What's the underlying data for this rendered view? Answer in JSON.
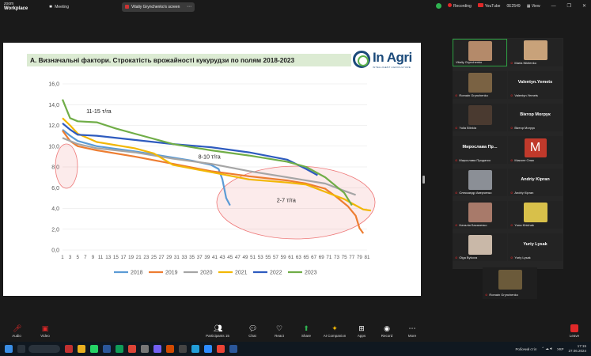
{
  "app": {
    "brand_line1": "zoom",
    "brand_line2": "Workplace"
  },
  "top_bar": {
    "meeting_label": "Meeting",
    "screen_chip": "Vitaliy Grynchenko's screen",
    "recording_label": "Recording",
    "youtube_label": "YouTube",
    "viewers_label": "0E2549"
  },
  "slide": {
    "title": "А. Визначальні фактори. Строкатість врожайності кукурудзи по полям 2018-2023",
    "logo_text": "In Agri",
    "logo_sub": "INTELLIGENT AGRICULTURE"
  },
  "chart_data": {
    "type": "line",
    "ylim": [
      0,
      16
    ],
    "yticks": [
      "0,0",
      "2,0",
      "4,0",
      "6,0",
      "8,0",
      "10,0",
      "12,0",
      "14,0",
      "16,0"
    ],
    "xticks": [
      "1",
      "3",
      "5",
      "7",
      "9",
      "11",
      "13",
      "15",
      "17",
      "19",
      "21",
      "23",
      "25",
      "27",
      "29",
      "31",
      "33",
      "35",
      "37",
      "39",
      "41",
      "43",
      "45",
      "47",
      "49",
      "51",
      "53",
      "55",
      "57",
      "59",
      "61",
      "63",
      "65",
      "67",
      "69",
      "71",
      "73",
      "75",
      "77",
      "79",
      "81"
    ],
    "annotations": [
      "11-15 т/га",
      "8-10 т/га",
      "2-7 т/га"
    ],
    "series": [
      {
        "name": "2018",
        "color": "#5b9bd5",
        "n": 45,
        "points": [
          [
            1,
            11.6
          ],
          [
            3,
            11.0
          ],
          [
            5,
            10.5
          ],
          [
            10,
            10.0
          ],
          [
            20,
            9.5
          ],
          [
            30,
            8.9
          ],
          [
            35,
            8.6
          ],
          [
            40,
            8.2
          ],
          [
            42,
            7.8
          ],
          [
            43,
            6.8
          ],
          [
            44,
            5.0
          ],
          [
            45,
            4.3
          ]
        ]
      },
      {
        "name": "2019",
        "color": "#ed7d31",
        "n": 80,
        "points": [
          [
            1,
            11.5
          ],
          [
            3,
            10.5
          ],
          [
            5,
            10.0
          ],
          [
            10,
            9.6
          ],
          [
            20,
            9.0
          ],
          [
            30,
            8.3
          ],
          [
            40,
            7.6
          ],
          [
            50,
            7.1
          ],
          [
            60,
            6.7
          ],
          [
            65,
            6.4
          ],
          [
            70,
            5.9
          ],
          [
            73,
            5.1
          ],
          [
            76,
            4.2
          ],
          [
            78,
            3.3
          ],
          [
            79,
            2.1
          ],
          [
            80,
            1.6
          ]
        ]
      },
      {
        "name": "2020",
        "color": "#a5a5a5",
        "n": 78,
        "points": [
          [
            1,
            10.8
          ],
          [
            3,
            10.5
          ],
          [
            5,
            10.2
          ],
          [
            10,
            9.8
          ],
          [
            20,
            9.4
          ],
          [
            30,
            8.8
          ],
          [
            40,
            8.3
          ],
          [
            50,
            7.6
          ],
          [
            60,
            7.0
          ],
          [
            70,
            6.4
          ],
          [
            75,
            5.7
          ],
          [
            78,
            5.3
          ]
        ]
      },
      {
        "name": "2021",
        "color": "#f2b705",
        "n": 82,
        "points": [
          [
            1,
            12.7
          ],
          [
            3,
            12.0
          ],
          [
            5,
            11.2
          ],
          [
            10,
            10.4
          ],
          [
            20,
            9.8
          ],
          [
            25,
            9.3
          ],
          [
            30,
            8.2
          ],
          [
            40,
            7.5
          ],
          [
            50,
            6.8
          ],
          [
            60,
            6.5
          ],
          [
            65,
            6.3
          ],
          [
            70,
            5.6
          ],
          [
            75,
            4.9
          ],
          [
            78,
            4.3
          ],
          [
            80,
            3.9
          ],
          [
            82,
            3.8
          ]
        ]
      },
      {
        "name": "2022",
        "color": "#2e5bbf",
        "n": 68,
        "points": [
          [
            1,
            12.2
          ],
          [
            3,
            11.6
          ],
          [
            5,
            11.1
          ],
          [
            10,
            11.0
          ],
          [
            20,
            10.6
          ],
          [
            30,
            10.2
          ],
          [
            40,
            9.9
          ],
          [
            50,
            9.4
          ],
          [
            60,
            8.7
          ],
          [
            65,
            7.8
          ],
          [
            68,
            7.2
          ]
        ]
      },
      {
        "name": "2023",
        "color": "#70ad47",
        "n": 77,
        "points": [
          [
            1,
            14.5
          ],
          [
            3,
            12.7
          ],
          [
            5,
            12.4
          ],
          [
            10,
            12.3
          ],
          [
            15,
            11.7
          ],
          [
            20,
            11.2
          ],
          [
            30,
            10.2
          ],
          [
            40,
            9.6
          ],
          [
            50,
            9.1
          ],
          [
            60,
            8.5
          ],
          [
            65,
            8.0
          ],
          [
            70,
            7.0
          ],
          [
            75,
            5.5
          ],
          [
            77,
            4.3
          ]
        ]
      }
    ]
  },
  "participants": [
    {
      "name": "Vitaliy Grynchenko",
      "caption": "Vitaliy Grynchenko",
      "video": true,
      "speaking": true,
      "color": "#b48a6a"
    },
    {
      "name": "Maria Nikitenko",
      "caption": "Maria Nikitenko",
      "video": true,
      "color": "#c8a27a"
    },
    {
      "name": "Romain Grynchenko",
      "caption": "Romain Grynchenko",
      "video": true,
      "color": "#7a6243"
    },
    {
      "name": "Valentyn.Yemets",
      "caption": "Valentyn.Yemets",
      "video": false
    },
    {
      "name": "Yulia Blinkia",
      "caption": "Yulia Blinkia",
      "video": true,
      "color": "#4a3a30"
    },
    {
      "name": "Віктор Могрук",
      "caption": "Віктор Могрук",
      "video": false
    },
    {
      "name": "Мирослава Пр...",
      "caption": "Мирослава Придатко",
      "video": false
    },
    {
      "name": "M",
      "caption": "Миколе Олах",
      "video": false,
      "avatar": "M"
    },
    {
      "name": "Олександр Аверченко",
      "caption": "Олександр Аверченко",
      "video": true,
      "color": "#8b8f96"
    },
    {
      "name": "Andriy Kipran",
      "caption": "Andriy Kipran",
      "video": false
    },
    {
      "name": "Наталія Басаченко",
      "caption": "Наталія Басаченко",
      "video": true,
      "color": "#a87a6a"
    },
    {
      "name": "Yuna Khichak",
      "caption": "Yuna Khichak",
      "video": true,
      "color": "#d8c04a"
    },
    {
      "name": "Olga Bykova",
      "caption": "Olga Bykova",
      "video": true,
      "color": "#c9b8a8"
    },
    {
      "name": "Yuriy Lysak",
      "caption": "Yuriy Lysak",
      "video": false
    }
  ],
  "extra_participant": {
    "caption": "Romain Grynchenko"
  },
  "toolbar": {
    "audio": "Audio",
    "video": "Video",
    "participants": "Participants",
    "participants_count": "15",
    "chat": "Chat",
    "react": "React",
    "share": "Share",
    "ai": "AI Companion",
    "apps": "Apps",
    "record": "Record",
    "more": "More",
    "leave": "Leave"
  },
  "taskbar": {
    "desktop_label": "Робочий стіл",
    "lang": "УКР",
    "time": "17:15",
    "date": "27.06.2024"
  }
}
